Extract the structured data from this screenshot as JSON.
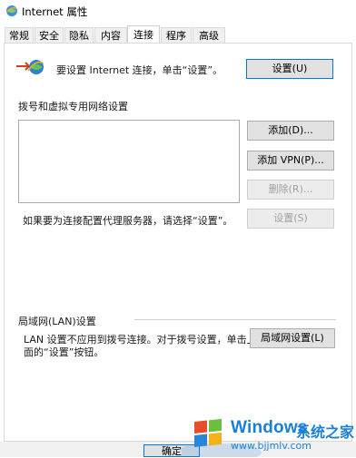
{
  "window": {
    "title": "Internet 属性"
  },
  "tabs": [
    {
      "label": "常规"
    },
    {
      "label": "安全"
    },
    {
      "label": "隐私"
    },
    {
      "label": "内容"
    },
    {
      "label": "连接",
      "active": true
    },
    {
      "label": "程序"
    },
    {
      "label": "高级"
    }
  ],
  "setup": {
    "text": "要设置 Internet 连接，单击“设置”。",
    "button": "设置(U)"
  },
  "dialup": {
    "heading": "拨号和虚拟专用网络设置",
    "add": "添加(D)...",
    "add_vpn": "添加 VPN(P)...",
    "remove": "删除(R)...",
    "proxy_note": "如果要为连接配置代理服务器，请选择“设置”。",
    "settings": "设置(S)"
  },
  "lan": {
    "heading": "局域网(LAN)设置",
    "note_line1": "LAN 设置不应用到拨号连接。对于拨号设置，单击上",
    "note_line2": "面的“设置”按钮。",
    "button": "局域网设置(L)"
  },
  "footer": {
    "ok": "确定"
  },
  "watermark": {
    "brand": "Windows",
    "suffix": "系统之家",
    "url": "www.bjjmlv.com"
  },
  "colors": {
    "accent": "#0078d7",
    "watermark": "#1a7fd6"
  }
}
